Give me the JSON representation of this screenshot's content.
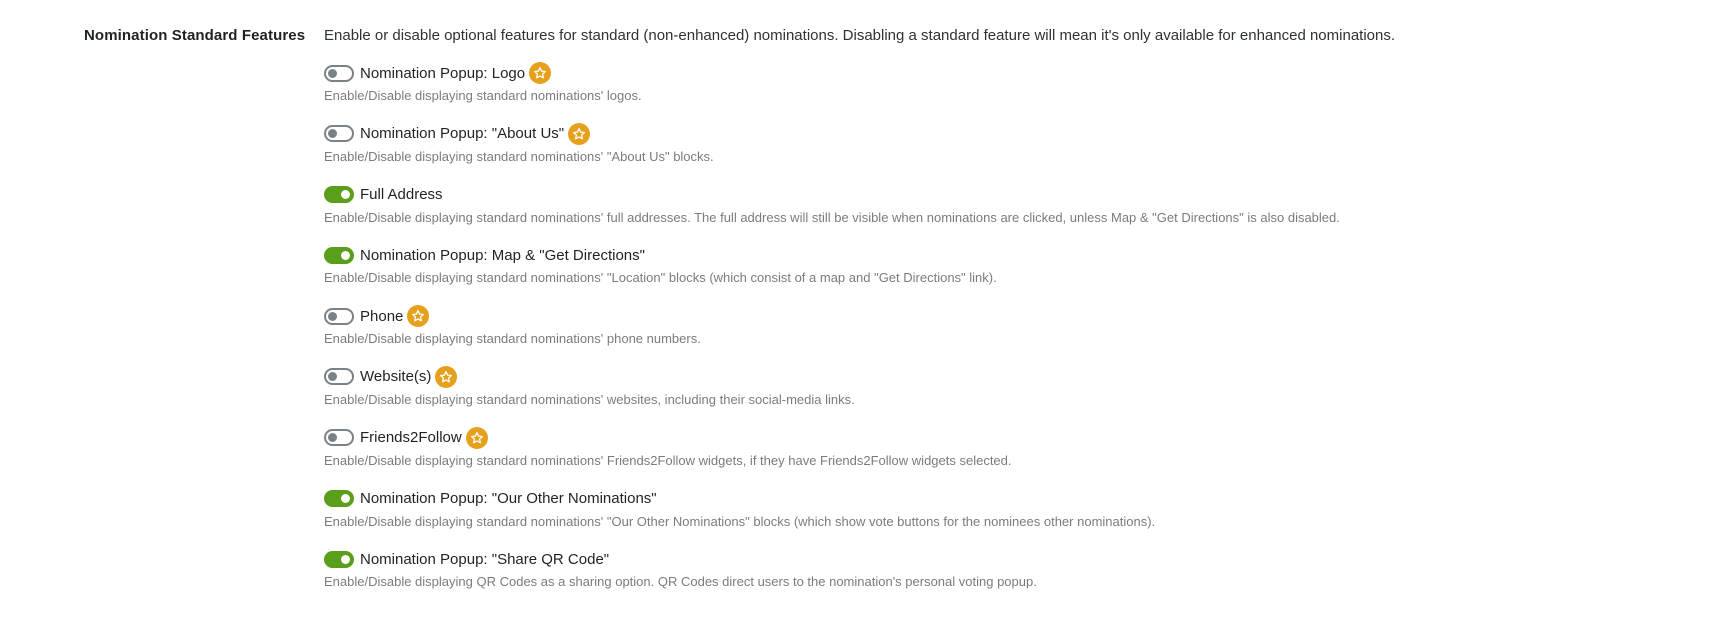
{
  "section": {
    "label": "Nomination Standard Features",
    "description": "Enable or disable optional features for standard (non-enhanced) nominations. Disabling a standard feature will mean it's only available for enhanced nominations."
  },
  "colors": {
    "toggle_on": "#5a9e1c",
    "toggle_off": "#7a8288",
    "premium_badge": "#e6a11c"
  },
  "features": [
    {
      "label": "Nomination Popup: Logo",
      "enabled": false,
      "premium": true,
      "icon": "star-icon",
      "help": "Enable/Disable displaying standard nominations' logos."
    },
    {
      "label": "Nomination Popup: \"About Us\"",
      "enabled": false,
      "premium": true,
      "icon": "star-icon",
      "help": "Enable/Disable displaying standard nominations' \"About Us\" blocks."
    },
    {
      "label": "Full Address",
      "enabled": true,
      "premium": false,
      "help": "Enable/Disable displaying standard nominations' full addresses. The full address will still be visible when nominations are clicked, unless Map & \"Get Directions\" is also disabled."
    },
    {
      "label": "Nomination Popup: Map & \"Get Directions\"",
      "enabled": true,
      "premium": false,
      "help": "Enable/Disable displaying standard nominations' \"Location\" blocks (which consist of a map and \"Get Directions\" link)."
    },
    {
      "label": "Phone",
      "enabled": false,
      "premium": true,
      "icon": "star-icon",
      "help": "Enable/Disable displaying standard nominations' phone numbers."
    },
    {
      "label": "Website(s)",
      "enabled": false,
      "premium": true,
      "icon": "star-icon",
      "help": "Enable/Disable displaying standard nominations' websites, including their social-media links."
    },
    {
      "label": "Friends2Follow",
      "enabled": false,
      "premium": true,
      "icon": "star-icon",
      "help": "Enable/Disable displaying standard nominations' Friends2Follow widgets, if they have Friends2Follow widgets selected."
    },
    {
      "label": "Nomination Popup: \"Our Other Nominations\"",
      "enabled": true,
      "premium": false,
      "help": "Enable/Disable displaying standard nominations' \"Our Other Nominations\" blocks (which show vote buttons for the nominees other nominations)."
    },
    {
      "label": "Nomination Popup: \"Share QR Code\"",
      "enabled": true,
      "premium": false,
      "help": "Enable/Disable displaying QR Codes as a sharing option. QR Codes direct users to the nomination's personal voting popup."
    }
  ]
}
